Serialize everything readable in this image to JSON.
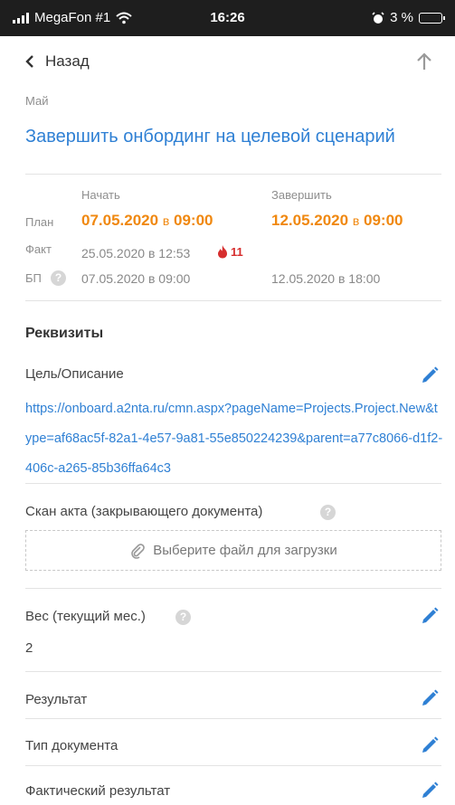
{
  "status_bar": {
    "carrier": "MegaFon #1",
    "time": "16:26",
    "battery": "3 %"
  },
  "header": {
    "back_label": "Назад"
  },
  "task": {
    "month": "Май",
    "title": "Завершить онбординг на целевой сценарий"
  },
  "schedule": {
    "col_start": "Начать",
    "col_end": "Завершить",
    "plan_label": "План",
    "plan_start_date": "07.05.2020",
    "plan_start_sep": "в",
    "plan_start_time": "09:00",
    "plan_end_date": "12.05.2020",
    "plan_end_sep": "в",
    "plan_end_time": "09:00",
    "fact_label": "Факт",
    "fact_start": "25.05.2020 в 12:53",
    "overdue_count": "11",
    "bp_label": "БП",
    "bp_start": "07.05.2020 в 09:00",
    "bp_end": "12.05.2020 в 18:00"
  },
  "requisites": {
    "section_title": "Реквизиты",
    "goal_label": "Цель/Описание",
    "goal_link": "https://onboard.a2nta.ru/cmn.aspx?pageName=Projects.Project.New&type=af68ac5f-82a1-4e57-9a81-55e850224239&parent=a77c8066-d1f2-406c-a265-85b36ffa64c3",
    "scan_label": "Скан акта (закрывающего документа)",
    "upload_label": "Выберите файл для загрузки",
    "weight_label": "Вес (текущий мес.)",
    "weight_value": "2",
    "result_label": "Результат",
    "doc_type_label": "Тип документа",
    "actual_result_label": "Фактический результат"
  },
  "colors": {
    "accent_blue": "#2f80d4",
    "plan_orange": "#f0880f",
    "overdue_red": "#d62e2e"
  }
}
